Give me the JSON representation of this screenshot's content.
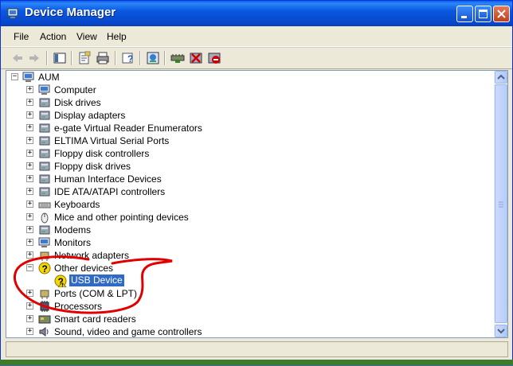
{
  "window": {
    "title": "Device Manager"
  },
  "menu": [
    "File",
    "Action",
    "View",
    "Help"
  ],
  "toolbar": {
    "icons": [
      "back-icon",
      "forward-icon",
      "show-hide-tree-icon",
      "properties-icon",
      "print-icon",
      "help-icon",
      "scan-hardware-icon",
      "update-driver-icon",
      "uninstall-icon",
      "disable-icon"
    ]
  },
  "tree": {
    "root": "AUM",
    "categories": [
      {
        "label": "Computer",
        "icon": "computer-icon",
        "expanded": false
      },
      {
        "label": "Disk drives",
        "icon": "disk-drive-icon",
        "expanded": false
      },
      {
        "label": "Display adapters",
        "icon": "display-adapter-icon",
        "expanded": false
      },
      {
        "label": "e-gate Virtual Reader Enumerators",
        "icon": "reader-icon",
        "expanded": false
      },
      {
        "label": "ELTIMA Virtual Serial Ports",
        "icon": "serial-port-icon",
        "expanded": false
      },
      {
        "label": "Floppy disk controllers",
        "icon": "floppy-controller-icon",
        "expanded": false
      },
      {
        "label": "Floppy disk drives",
        "icon": "floppy-drive-icon",
        "expanded": false
      },
      {
        "label": "Human Interface Devices",
        "icon": "hid-icon",
        "expanded": false
      },
      {
        "label": "IDE ATA/ATAPI controllers",
        "icon": "ide-controller-icon",
        "expanded": false
      },
      {
        "label": "Keyboards",
        "icon": "keyboard-icon",
        "expanded": false
      },
      {
        "label": "Mice and other pointing devices",
        "icon": "mouse-icon",
        "expanded": false
      },
      {
        "label": "Modems",
        "icon": "modem-icon",
        "expanded": false
      },
      {
        "label": "Monitors",
        "icon": "monitor-icon",
        "expanded": false
      },
      {
        "label": "Network adapters",
        "icon": "network-adapter-icon",
        "expanded": false
      },
      {
        "label": "Other devices",
        "icon": "unknown-device-icon",
        "expanded": true
      },
      {
        "label": "USB Device",
        "icon": "warning-device-icon",
        "child": true,
        "selected": true
      },
      {
        "label": "Ports (COM & LPT)",
        "icon": "port-icon",
        "expanded": false
      },
      {
        "label": "Processors",
        "icon": "processor-icon",
        "expanded": false
      },
      {
        "label": "Smart card readers",
        "icon": "smart-card-icon",
        "expanded": false
      },
      {
        "label": "Sound, video and game controllers",
        "icon": "sound-icon",
        "expanded": false
      }
    ]
  },
  "colors": {
    "selection": "#316ac5",
    "titlebar": "#0a5fe8",
    "annotation": "#e00000"
  }
}
